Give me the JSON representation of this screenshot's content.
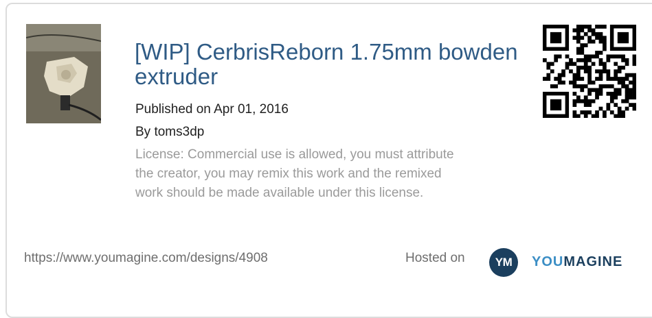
{
  "design": {
    "title": "[WIP] CerbrisReborn 1.75mm bowden extruder",
    "published": "Published on Apr 01, 2016",
    "author": "By toms3dp",
    "license": "License: Commercial use is allowed, you must attribute the creator, you may remix this work and the remixed work should be made available under this license."
  },
  "footer": {
    "url": "https://www.youmagine.com/designs/4908",
    "hosted_label": "Hosted on",
    "logo_badge": "YM",
    "logo_you": "YOU",
    "logo_magine": "MAGINE"
  },
  "colors": {
    "title": "#2f5b85",
    "logo_dark": "#1b3f5e",
    "logo_light": "#3b8ec5",
    "license_text": "#9a9a9a"
  }
}
